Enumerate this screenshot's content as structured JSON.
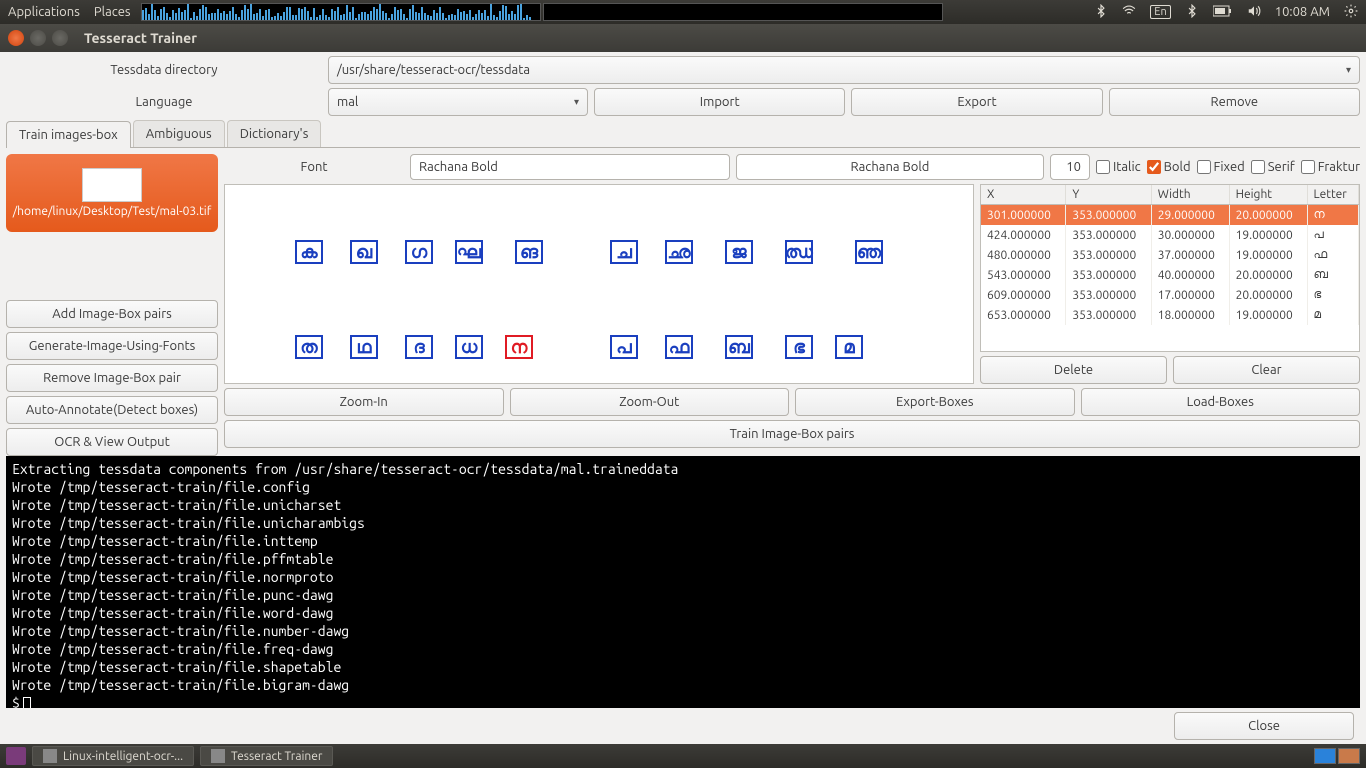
{
  "topbar": {
    "applications": "Applications",
    "places": "Places",
    "lang_indicator": "En",
    "time": "10:08 AM"
  },
  "window": {
    "title": "Tesseract Trainer"
  },
  "form": {
    "tessdata_label": "Tessdata directory",
    "tessdata_value": "/usr/share/tesseract-ocr/tessdata",
    "language_label": "Language",
    "language_value": "mal",
    "import_btn": "Import",
    "export_btn": "Export",
    "remove_btn": "Remove"
  },
  "tabs": {
    "train": "Train images-box",
    "ambiguous": "Ambiguous",
    "dictionary": "Dictionary's"
  },
  "thumb": {
    "path": "/home/linux/Desktop/Test/mal-03.tif"
  },
  "left_buttons": {
    "add": "Add Image-Box pairs",
    "generate": "Generate-Image-Using-Fonts",
    "remove": "Remove Image-Box pair",
    "auto": "Auto-Annotate(Detect boxes)",
    "ocr": "OCR & View Output"
  },
  "font": {
    "label": "Font",
    "name": "Rachana Bold",
    "display_name": "Rachana Bold",
    "size": "10",
    "italic": "Italic",
    "bold": "Bold",
    "fixed": "Fixed",
    "serif": "Serif",
    "fraktur": "Fraktur"
  },
  "glyphs_row1": [
    "ക",
    "ഖ",
    "ഗ",
    "ഘ",
    "ങ",
    "ച",
    "ഛ",
    "ജ",
    "ഝ",
    "ഞ"
  ],
  "glyphs_row2": [
    "ത",
    "ഥ",
    "ദ",
    "ധ",
    "ന",
    "പ",
    "ഫ",
    "ബ",
    "ഭ",
    "മ"
  ],
  "table": {
    "headers": {
      "x": "X",
      "y": "Y",
      "width": "Width",
      "height": "Height",
      "letter": "Letter"
    },
    "rows": [
      {
        "x": "301.000000",
        "y": "353.000000",
        "w": "29.000000",
        "h": "20.000000",
        "l": "ന"
      },
      {
        "x": "424.000000",
        "y": "353.000000",
        "w": "30.000000",
        "h": "19.000000",
        "l": "പ"
      },
      {
        "x": "480.000000",
        "y": "353.000000",
        "w": "37.000000",
        "h": "19.000000",
        "l": "ഫ"
      },
      {
        "x": "543.000000",
        "y": "353.000000",
        "w": "40.000000",
        "h": "20.000000",
        "l": "ബ"
      },
      {
        "x": "609.000000",
        "y": "353.000000",
        "w": "17.000000",
        "h": "20.000000",
        "l": "ഭ"
      },
      {
        "x": "653.000000",
        "y": "353.000000",
        "w": "18.000000",
        "h": "19.000000",
        "l": "മ"
      }
    ],
    "delete_btn": "Delete",
    "clear_btn": "Clear"
  },
  "bottom_buttons": {
    "zoom_in": "Zoom-In",
    "zoom_out": "Zoom-Out",
    "export_boxes": "Export-Boxes",
    "load_boxes": "Load-Boxes",
    "train": "Train Image-Box pairs"
  },
  "terminal_lines": [
    "Extracting tessdata components from /usr/share/tesseract-ocr/tessdata/mal.traineddata",
    "Wrote /tmp/tesseract-train/file.config",
    "Wrote /tmp/tesseract-train/file.unicharset",
    "Wrote /tmp/tesseract-train/file.unicharambigs",
    "Wrote /tmp/tesseract-train/file.inttemp",
    "Wrote /tmp/tesseract-train/file.pffmtable",
    "Wrote /tmp/tesseract-train/file.normproto",
    "Wrote /tmp/tesseract-train/file.punc-dawg",
    "Wrote /tmp/tesseract-train/file.word-dawg",
    "Wrote /tmp/tesseract-train/file.number-dawg",
    "Wrote /tmp/tesseract-train/file.freq-dawg",
    "Wrote /tmp/tesseract-train/file.shapetable",
    "Wrote /tmp/tesseract-train/file.bigram-dawg"
  ],
  "terminal_prompt": "$ ",
  "footer": {
    "close": "Close"
  },
  "taskbar": {
    "task1": "Linux-intelligent-ocr-...",
    "task2": "Tesseract Trainer"
  }
}
